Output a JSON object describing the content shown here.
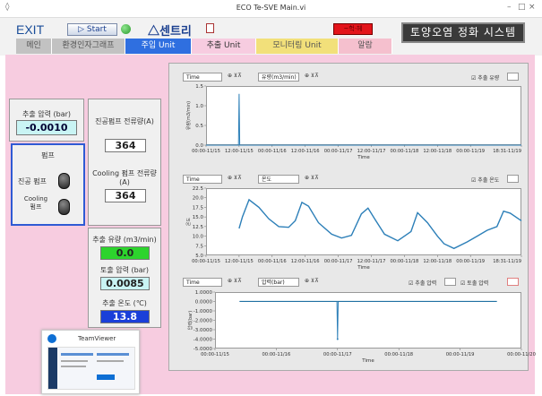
{
  "window": {
    "title": "ECO Te-SVE Main.vi",
    "controls": [
      "–",
      "□",
      "×"
    ]
  },
  "toolbar": {
    "exit": "EXIT",
    "start": "Start",
    "logo": "센트리",
    "red_button": "~헉·헤",
    "system_title": "토양오염 정화 시스템"
  },
  "tabs": [
    {
      "label": "메인",
      "bg": "#c2c2c2",
      "color": "#555"
    },
    {
      "label": "환경인자그래프",
      "bg": "#c2c2c2",
      "color": "#555"
    },
    {
      "label": "주입 Unit",
      "bg": "#2f6fe0",
      "color": "#fff"
    },
    {
      "label": "추출 Unit",
      "bg": "#f7cce0",
      "color": "#333"
    },
    {
      "label": "모니터링 Unit",
      "bg": "#f2e07a",
      "color": "#555"
    },
    {
      "label": "알람",
      "bg": "#f5c0ce",
      "color": "#555"
    }
  ],
  "left": {
    "pressure_label": "추출 압력 (bar)",
    "pressure_value": "-0.0010",
    "pump_title": "펌프",
    "vacuum_pump": "진공 펌프",
    "cooling_pump": "Cooling 펌프",
    "vac_current_label": "진공펌프 전류량(A)",
    "vac_current_value": "364",
    "cool_current_label": "Cooling 펌프 전류량 (A)",
    "cool_current_value": "364",
    "flow_label": "추출 유량 (m3/min)",
    "flow_value": "0.0",
    "out_pressure_label": "토출 압력 (bar)",
    "out_pressure_value": "0.0085",
    "temp_label": "추출 온도 (℃)",
    "temp_value": "13.8"
  },
  "charts": {
    "c1": {
      "xsel": "Time",
      "ysel": "유량(m3/min)",
      "legend": "추출 유량"
    },
    "c2": {
      "xsel": "Time",
      "ysel": "온도",
      "legend": "추출 온도"
    },
    "c3": {
      "xsel": "Time",
      "ysel": "압력(bar)",
      "legend1": "추출 압력",
      "legend2": "토출 압력"
    },
    "x_label": "Time"
  },
  "chart_data": [
    {
      "type": "line",
      "ylabel": "유량(m3/min)",
      "ylim": [
        0,
        1.5
      ],
      "yticks": [
        "1.5",
        "1.0",
        "0.5",
        "0.0"
      ],
      "xticks": [
        "00:00-11/15",
        "12:00-11/15",
        "00:00-11/16",
        "12:00-11/16",
        "00:00-11/17",
        "12:00-11/17",
        "00:00-11/18",
        "12:00-11/18",
        "00:00-11/19",
        "18:31-11/19"
      ],
      "xlim": [
        0,
        4.77
      ],
      "series": [
        {
          "name": "추출 유량",
          "x": [
            0,
            0.49,
            0.5,
            0.51,
            4.77
          ],
          "y": [
            0,
            0,
            1.3,
            0,
            0
          ]
        }
      ]
    },
    {
      "type": "line",
      "ylabel": "온도",
      "ylim": [
        5,
        22.5
      ],
      "yticks": [
        "22.5",
        "20.0",
        "17.5",
        "15.0",
        "12.5",
        "10.0",
        "7.5",
        "5.0"
      ],
      "xticks": [
        "00:00-11/15",
        "12:00-11/15",
        "00:00-11/16",
        "12:00-11/16",
        "00:00-11/17",
        "12:00-11/17",
        "00:00-11/18",
        "12:00-11/18",
        "00:00-11/19",
        "18:31-11/19"
      ],
      "xlim": [
        0,
        4.77
      ],
      "series": [
        {
          "name": "추출 온도",
          "x": [
            0.5,
            0.55,
            0.65,
            0.8,
            0.95,
            1.1,
            1.25,
            1.35,
            1.45,
            1.55,
            1.7,
            1.9,
            2.05,
            2.2,
            2.35,
            2.45,
            2.55,
            2.7,
            2.9,
            3.1,
            3.2,
            3.35,
            3.5,
            3.6,
            3.75,
            3.95,
            4.1,
            4.25,
            4.4,
            4.5,
            4.6,
            4.77
          ],
          "y": [
            12,
            15,
            19.5,
            17.5,
            14.5,
            12.5,
            12.3,
            14,
            18.8,
            17.8,
            13.5,
            10.5,
            9.5,
            10.2,
            15.8,
            17.3,
            14.5,
            10.5,
            8.8,
            11.2,
            16.1,
            13.5,
            10,
            8,
            6.8,
            8.5,
            10,
            11.5,
            12.5,
            16.5,
            16,
            14
          ]
        }
      ]
    },
    {
      "type": "line",
      "ylabel": "압력(bar)",
      "ylim": [
        -5,
        1
      ],
      "yticks": [
        "1.0000",
        "0.0000",
        "-1.0000",
        "-2.0000",
        "-3.0000",
        "-4.0000",
        "-5.0000"
      ],
      "xticks": [
        "00:00-11/15",
        "00:00-11/16",
        "00:00-11/17",
        "00:00-11/18",
        "00:00-11/19",
        "00:00-11/20"
      ],
      "xlim": [
        0,
        5
      ],
      "series": [
        {
          "name": "추출 압력",
          "x": [
            0.4,
            1.99,
            2.0,
            2.01,
            4.6
          ],
          "y": [
            0,
            0,
            -4,
            0,
            0
          ]
        },
        {
          "name": "토출 압력",
          "x": [
            0.4,
            4.6
          ],
          "y": [
            0.01,
            0.01
          ]
        }
      ]
    }
  ],
  "teamviewer": {
    "title": "TeamViewer"
  },
  "colors": {
    "line": "#2c7fb8",
    "content_bg": "#f7cce0"
  }
}
